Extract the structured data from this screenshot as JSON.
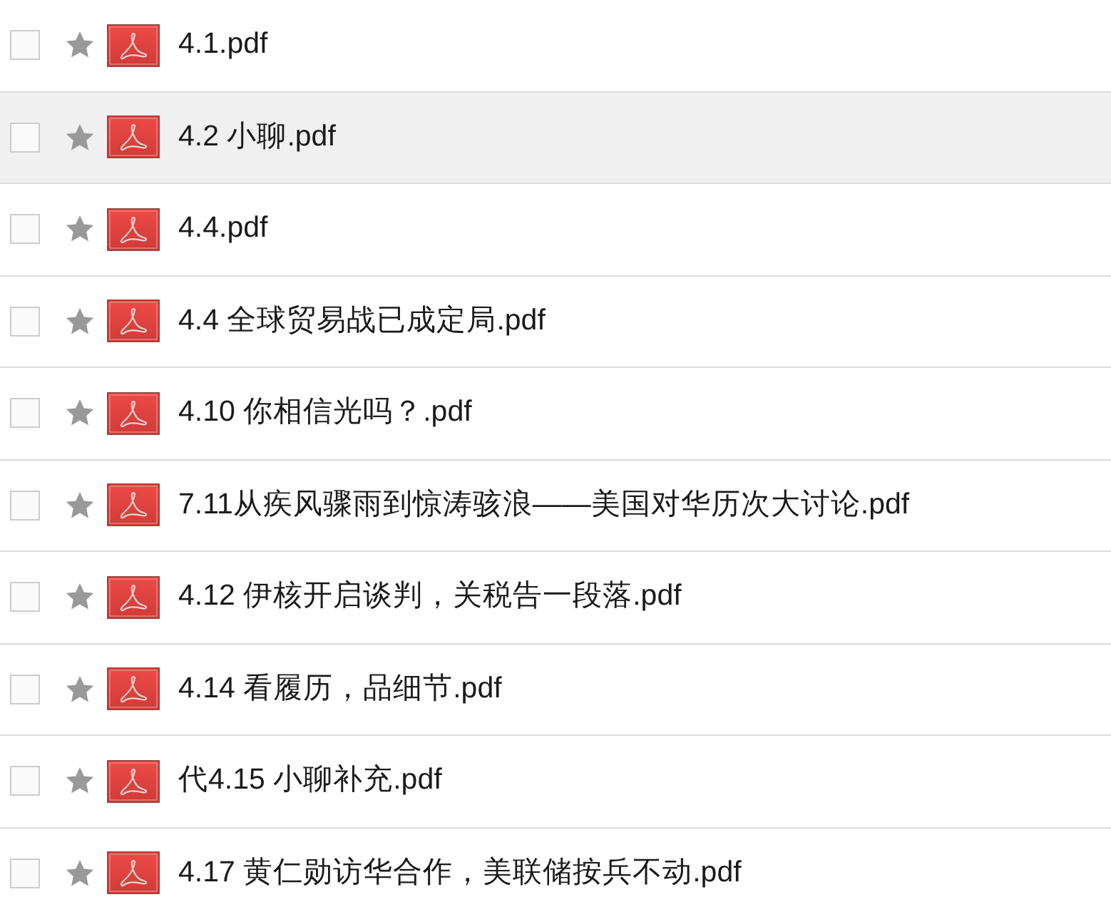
{
  "files": [
    {
      "name": "4.1.pdf",
      "checked": false,
      "starred": false,
      "highlighted": false
    },
    {
      "name": "4.2 小聊.pdf",
      "checked": false,
      "starred": false,
      "highlighted": true
    },
    {
      "name": "4.4.pdf",
      "checked": false,
      "starred": false,
      "highlighted": false
    },
    {
      "name": "4.4 全球贸易战已成定局.pdf",
      "checked": false,
      "starred": false,
      "highlighted": false
    },
    {
      "name": "4.10 你相信光吗？.pdf",
      "checked": false,
      "starred": false,
      "highlighted": false
    },
    {
      "name": "7.11从疾风骤雨到惊涛骇浪——美国对华历次大讨论.pdf",
      "checked": false,
      "starred": false,
      "highlighted": false
    },
    {
      "name": "4.12 伊核开启谈判，关税告一段落.pdf",
      "checked": false,
      "starred": false,
      "highlighted": false
    },
    {
      "name": "4.14 看履历，品细节.pdf",
      "checked": false,
      "starred": false,
      "highlighted": false
    },
    {
      "name": "代4.15 小聊补充.pdf",
      "checked": false,
      "starred": false,
      "highlighted": false
    },
    {
      "name": "4.17 黄仁勋访华合作，美联储按兵不动.pdf",
      "checked": false,
      "starred": false,
      "highlighted": false
    }
  ]
}
